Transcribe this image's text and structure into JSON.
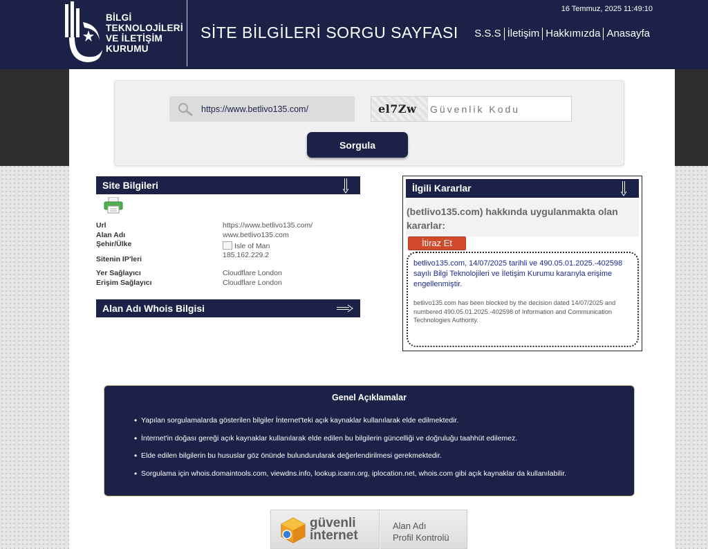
{
  "header": {
    "logo_lines": [
      "BİLGİ",
      "TEKNOLOJİLERİ",
      "VE İLETİŞİM",
      "KURUMU"
    ],
    "page_title": "SİTE BİLGİLERİ SORGU SAYFASI",
    "datetime": "16 Temmuz, 2025 11:49:10",
    "nav": [
      "S.S.S",
      "İletişim",
      "Hakkımızda",
      "Anasayfa"
    ]
  },
  "search": {
    "url_value": "https://www.betlivo135.com/",
    "captcha_code": "el7Zw",
    "captcha_placeholder": "Güvenlik Kodu",
    "submit_label": "Sorgula"
  },
  "site_info": {
    "title": "Site Bilgileri",
    "rows": [
      {
        "label": "Url",
        "value": "https://www.betlivo135.com/"
      },
      {
        "label": "Alan Adı",
        "value": "www.betlivo135.com"
      },
      {
        "label": "Şehir/Ülke",
        "value": "Isle of Man"
      },
      {
        "label": "Sitenin IP'leri",
        "value": "185.162.229.2"
      },
      {
        "label": "Yer Sağlayıcı",
        "value": "Cloudflare London"
      },
      {
        "label": "Erişim Sağlayıcı",
        "value": "Cloudflare London"
      }
    ]
  },
  "whois": {
    "title": "Alan Adı Whois Bilgisi"
  },
  "decisions": {
    "title": "İlgili Kararlar",
    "subtitle": "(betlivo135.com) hakkında uygulanmakta olan kararlar:",
    "objection_label": "İtiraz Et",
    "text_tr": "betlivo135.com, 14/07/2025 tarihli ve 490.05.01.2025.-402598 sayılı Bilgi Teknolojileri ve İletişim Kurumu kararıyla erişime engellenmiştir.",
    "text_en": "betlivo135.com has been blocked by the decision dated 14/07/2025 and numbered 490.05.01.2025.-402598 of Information and Communication Technologies Authority."
  },
  "notes": {
    "title": "Genel Açıklamalar",
    "items": [
      "Yapılan sorgulamalarda gösterilen bilgiler İnternet'teki açık kaynaklar kullanılarak elde edilmektedir.",
      "İnternet'in doğası gereği açık kaynaklar kullanılarak elde edilen bu bilgilerin güncelliği ve doğruluğu taahhüt edilemez.",
      "Elde edilen bilgilerin bu hususlar göz önünde bulundurularak değerlendirilmesi gerekmektedir.",
      "Sorgulama için whois.domaintools.com, viewdns.info, lookup.icann.org, iplocation.net, whois.com gibi açık kaynaklar da kullanılabilir."
    ]
  },
  "badge": {
    "brand_line1": "güvenli",
    "brand_line2": "internet",
    "text_line1": "Alan Adı",
    "text_line2": "Profil Kontrolü"
  },
  "colors": {
    "navy": "#1c2147",
    "objection_red": "#d04a2b",
    "decision_blue": "#1c2a8f"
  }
}
